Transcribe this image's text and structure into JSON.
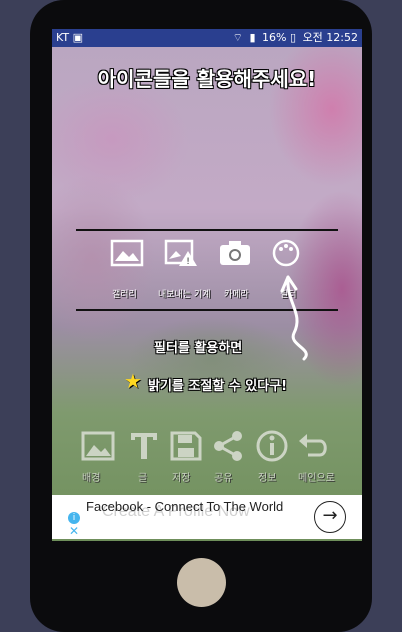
{
  "status": {
    "carrier": "KT",
    "battery": "16%",
    "time": "오전 12:52"
  },
  "title": "아이콘들을 활용해주세요!",
  "top_icons": [
    {
      "icon": "gallery-icon",
      "label": "갤러리"
    },
    {
      "icon": "image-warning-icon",
      "label": "내보내는 기계"
    },
    {
      "icon": "camera-icon",
      "label": "카메라"
    },
    {
      "icon": "filter-palette-icon",
      "label": "필터"
    }
  ],
  "annotation": {
    "line1": "필터를 활용하면",
    "line2": "밝기를 조절할 수 있다구!"
  },
  "bottom_icons": [
    {
      "icon": "background-image-icon",
      "label": "배경"
    },
    {
      "icon": "text-icon",
      "label": "글"
    },
    {
      "icon": "save-icon",
      "label": "저장"
    },
    {
      "icon": "share-icon",
      "label": "공유"
    },
    {
      "icon": "info-icon",
      "label": "정보"
    },
    {
      "icon": "undo-icon",
      "label": "메인으로"
    }
  ],
  "ad": {
    "text": "Facebook - Connect To The World",
    "ghost_text": "Create A Profile Now"
  }
}
